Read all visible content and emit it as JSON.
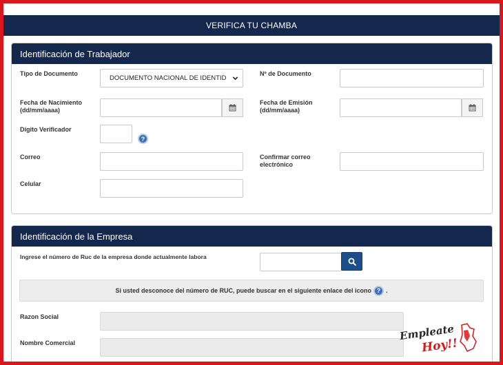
{
  "header": {
    "title": "VERIFICA TU CHAMBA"
  },
  "worker_panel": {
    "title": "Identificación de Trabajador",
    "doc_type_label": "Tipo de Documento",
    "doc_type_value": "DOCUMENTO NACIONAL DE IDENTID",
    "doc_number_label": "Nº de Documento",
    "birth_date_label_1": "Fecha de Nacimiento",
    "birth_date_label_2": "(dd/mm/aaaa)",
    "issue_date_label_1": "Fecha de Emisión",
    "issue_date_label_2": "(dd/mm/aaaa)",
    "check_digit_label": "Dígito Verificador",
    "email_label": "Correo",
    "confirm_email_label_1": "Confirmar correo",
    "confirm_email_label_2": "electrónico",
    "cell_label": "Celular",
    "help_glyph": "?"
  },
  "company_panel": {
    "title": "Identificación de la Empresa",
    "ruc_label": "Ingrese el número de Ruc de la empresa donde actualmente labora",
    "info_text": "Si usted desconoce del número de RUC, puede buscar en el siguiente enlace del icono",
    "info_suffix": ".",
    "business_name_label": "Razon Social",
    "trade_name_label": "Nombre Comercial",
    "help_glyph": "?"
  },
  "watermark": {
    "line1": "Empleate",
    "line2": "Hoy!!"
  },
  "colors": {
    "navy": "#14274d",
    "frame_red": "#d9161c",
    "search_button": "#1c4e8a",
    "help_icon": "#3f6fb3"
  },
  "icons": [
    "chevron-down-icon",
    "calendar-icon",
    "help-icon",
    "search-icon"
  ]
}
